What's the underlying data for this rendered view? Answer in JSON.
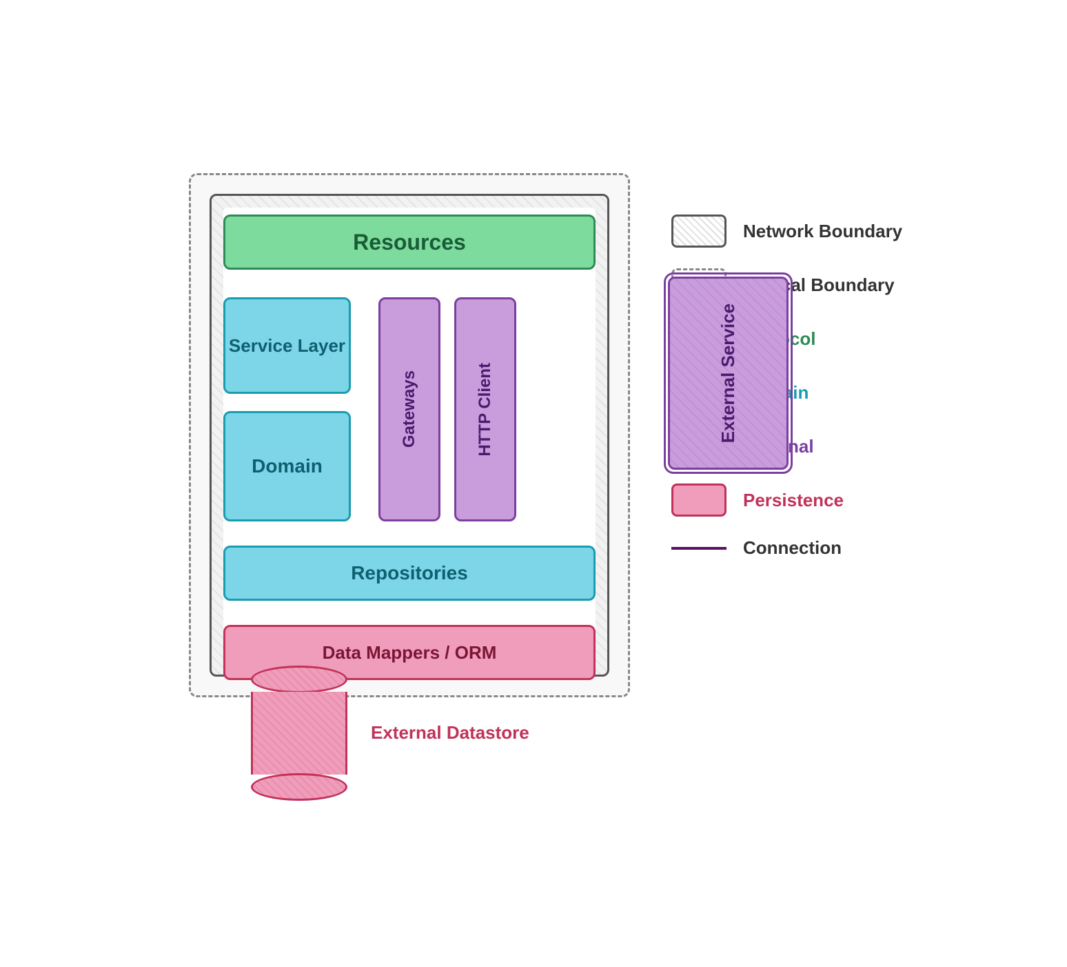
{
  "diagram": {
    "boxes": {
      "resources": "Resources",
      "service_layer": "Service Layer",
      "domain": "Domain",
      "gateways": "Gateways",
      "http_client": "HTTP Client",
      "repositories": "Repositories",
      "data_mappers": "Data Mappers / ORM",
      "external_service": "External Service",
      "external_datastore": "External Datastore"
    }
  },
  "legend": {
    "items": [
      {
        "key": "network_boundary",
        "type": "network",
        "label": "Network Boundary",
        "label_class": "dark"
      },
      {
        "key": "logical_boundary",
        "type": "logical",
        "label": "Logical Boundary",
        "label_class": "dark"
      },
      {
        "key": "protocol",
        "type": "protocol",
        "label": "Protocol",
        "label_class": "green"
      },
      {
        "key": "domain",
        "type": "domain",
        "label": "Domain",
        "label_class": "teal"
      },
      {
        "key": "external",
        "type": "external",
        "label": "External",
        "label_class": "purple"
      },
      {
        "key": "persistence",
        "type": "persistence",
        "label": "Persistence",
        "label_class": "pink"
      },
      {
        "key": "connection",
        "type": "line",
        "label": "Connection",
        "label_class": "dark"
      }
    ]
  }
}
